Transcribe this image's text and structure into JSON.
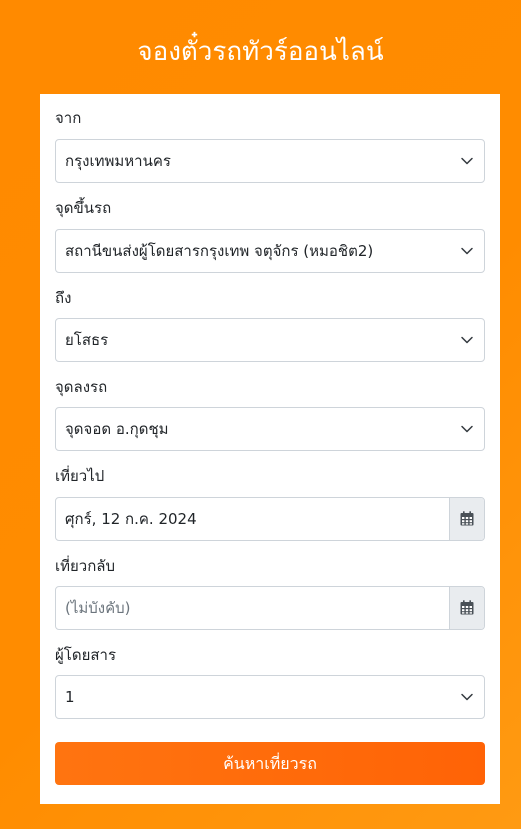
{
  "header": {
    "title": "จองตั๋วรถทัวร์ออนไลน์"
  },
  "form": {
    "origin": {
      "label": "จาก",
      "value": "กรุงเทพมหานคร"
    },
    "boarding": {
      "label": "จุดขึ้นรถ",
      "value": "สถานีขนส่งผู้โดยสารกรุงเทพ จตุจักร (หมอชิต2)"
    },
    "destination": {
      "label": "ถึง",
      "value": "ยโสธร"
    },
    "dropoff": {
      "label": "จุดลงรถ",
      "value": "จุดจอด อ.กุดชุม"
    },
    "depart": {
      "label": "เที่ยวไป",
      "value": "ศุกร์, 12 ก.ค. 2024"
    },
    "return": {
      "label": "เที่ยวกลับ",
      "placeholder": "(ไม่บังคับ)"
    },
    "passengers": {
      "label": "ผู้โดยสาร",
      "value": "1"
    },
    "search_button_label": "ค้นหาเที่ยวรถ"
  },
  "icons": {
    "select_arrow": "chevron-down-icon",
    "date_picker": "calendar-icon"
  },
  "colors": {
    "background": "#ff8c00",
    "button": "#ff6a0a",
    "calendar_addon": "#e9ecef"
  }
}
